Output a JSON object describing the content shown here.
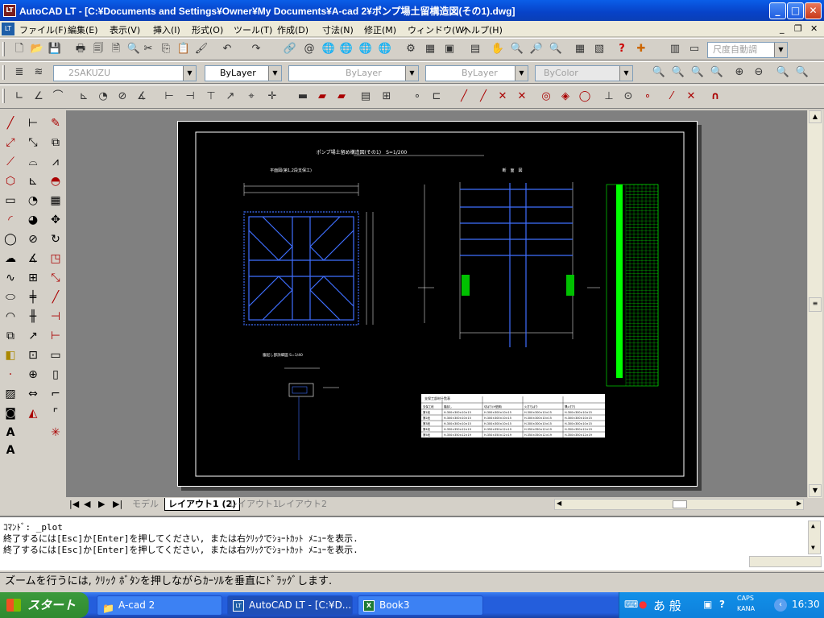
{
  "window": {
    "title": "AutoCAD LT - [C:¥Documents and Settings¥Owner¥My Documents¥A-cad 2¥ポンプ場土留構造図(その1).dwg]",
    "icon_label": "LT"
  },
  "menu": [
    "ファイル(F)",
    "編集(E)",
    "表示(V)",
    "挿入(I)",
    "形式(O)",
    "ツール(T)",
    "作成(D)",
    "寸法(N)",
    "修正(M)",
    "ウィンドウ(W)",
    "ヘルプ(H)"
  ],
  "toolbar": {
    "dimstyle": "尺度自動調",
    "layer": "2SAKUZU",
    "color": "ByLayer",
    "linetype": "ByLayer",
    "lineweight": "ByLayer",
    "plotstyle": "ByColor"
  },
  "drawing": {
    "title": "ポンプ場土留め構造図(その1)　S=1/200",
    "plan_label": "平面図(第1,2段支保工)",
    "section_label": "断　面　図",
    "detail_label": "腹起し部詳細図 S=1/40",
    "table_title": "支保工部材一覧表",
    "table_headers": [
      "支保工段",
      "腹起し",
      "切ばり(H型鋼)",
      "火打ちばり",
      "隅火打ち"
    ],
    "table_rows": [
      [
        "第1段",
        "H-300×300×10×15",
        "H-300×300×10×15",
        "H-300×300×10×15",
        "H-300×300×10×15"
      ],
      [
        "第2段",
        "H-300×300×10×15",
        "H-300×300×10×15",
        "H-300×300×10×15",
        "H-300×300×10×15"
      ],
      [
        "第3段",
        "H-300×300×10×15",
        "H-300×300×10×15",
        "H-300×300×10×15",
        "H-300×300×10×15"
      ],
      [
        "第4段",
        "H-350×350×12×19",
        "H-350×350×12×19",
        "H-350×350×12×19",
        "H-350×350×12×19"
      ],
      [
        "第5段",
        "H-350×350×12×19",
        "H-350×350×12×19",
        "H-350×350×12×19",
        "H-350×350×12×19"
      ]
    ]
  },
  "tabs": [
    "モデル",
    "レイアウト1 (2)",
    "レイアウト1",
    "レイアウト2"
  ],
  "command": {
    "line1": "ｺﾏﾝﾄﾞ: _plot",
    "line2": "終了するには[Esc]か[Enter]を押してください, または右ｸﾘｯｸでｼｮｰﾄｶｯﾄ ﾒﾆｭｰを表示.",
    "line3": "終了するには[Esc]か[Enter]を押してください, または右ｸﾘｯｸでｼｮｰﾄｶｯﾄ ﾒﾆｭｰを表示."
  },
  "status": "ズームを行うには, ｸﾘｯｸ ﾎﾞﾀﾝを押しながらｶｰｿﾙを垂直にﾄﾞﾗｯｸﾞします.",
  "taskbar": {
    "start": "スタート",
    "tasks": [
      "A-cad 2",
      "AutoCAD LT - [C:¥D...",
      "Book3"
    ],
    "ime": "あ 般",
    "caps": "CAPS",
    "kana": "KANA",
    "clock": "16:30"
  },
  "colors": {
    "titlebar": "#0742c8",
    "paper": "#000000",
    "drawing_blue": "#3f6fff",
    "drawing_green": "#00ff00"
  }
}
